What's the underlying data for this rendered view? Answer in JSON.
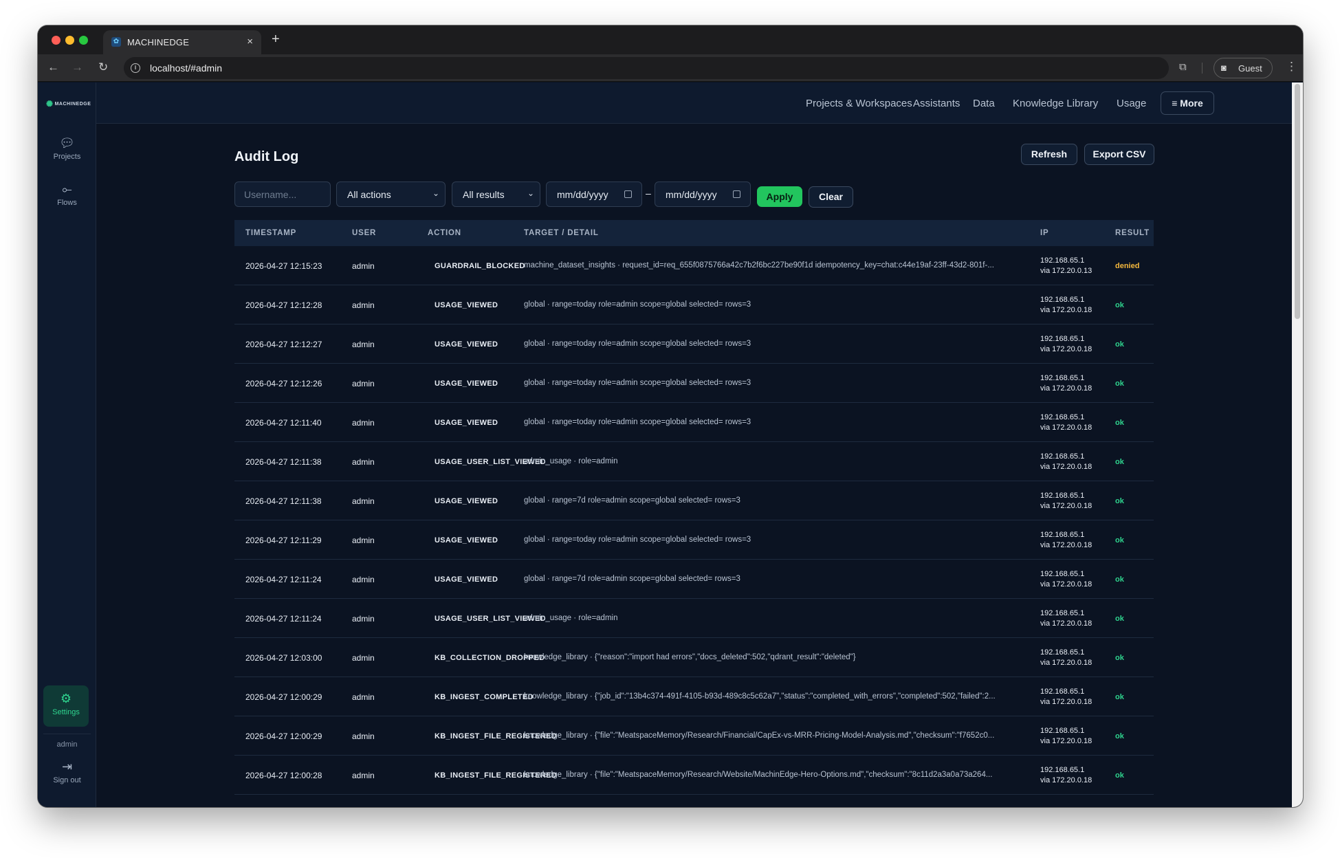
{
  "browser": {
    "tab_title": "MACHINEDGE",
    "url": "localhost/#admin",
    "guest_label": "Guest",
    "new_tab": "+",
    "close": "×"
  },
  "sidebar": {
    "logo": "MACHINEDGE",
    "items": [
      {
        "label": "Projects",
        "icon": "chat-bubble-icon"
      },
      {
        "label": "Flows",
        "icon": "flow-icon"
      }
    ],
    "settings_label": "Settings",
    "user": "admin",
    "signout_label": "Sign out"
  },
  "topnav": {
    "links": [
      "Projects & Workspaces",
      "Assistants",
      "Data",
      "Knowledge Library",
      "Usage"
    ],
    "more_label": "≡ More"
  },
  "page": {
    "title": "Audit Log",
    "refresh_label": "Refresh",
    "export_label": "Export CSV",
    "filters": {
      "username_placeholder": "Username...",
      "actions_value": "All actions",
      "results_value": "All results",
      "date_from": "mm/dd/yyyy",
      "date_to": "mm/dd/yyyy",
      "dash": "–",
      "apply_label": "Apply",
      "clear_label": "Clear"
    },
    "columns": [
      "TIMESTAMP",
      "USER",
      "ACTION",
      "TARGET / DETAIL",
      "IP",
      "RESULT"
    ],
    "rows": [
      {
        "ts": "2026-04-27 12:15:23",
        "user": "admin",
        "action": "GUARDRAIL_BLOCKED",
        "target": "machine_dataset_insights · request_id=req_655f0875766a42c7b2f6bc227be90f1d idempotency_key=chat:c44e19af-23ff-43d2-801f-...",
        "ip1": "192.168.65.1",
        "ip2": "via 172.20.0.13",
        "result": "denied"
      },
      {
        "ts": "2026-04-27 12:12:28",
        "user": "admin",
        "action": "USAGE_VIEWED",
        "target": "global · range=today role=admin scope=global selected= rows=3",
        "ip1": "192.168.65.1",
        "ip2": "via 172.20.0.18",
        "result": "ok"
      },
      {
        "ts": "2026-04-27 12:12:27",
        "user": "admin",
        "action": "USAGE_VIEWED",
        "target": "global · range=today role=admin scope=global selected= rows=3",
        "ip1": "192.168.65.1",
        "ip2": "via 172.20.0.18",
        "result": "ok"
      },
      {
        "ts": "2026-04-27 12:12:26",
        "user": "admin",
        "action": "USAGE_VIEWED",
        "target": "global · range=today role=admin scope=global selected= rows=3",
        "ip1": "192.168.65.1",
        "ip2": "via 172.20.0.18",
        "result": "ok"
      },
      {
        "ts": "2026-04-27 12:11:40",
        "user": "admin",
        "action": "USAGE_VIEWED",
        "target": "global · range=today role=admin scope=global selected= rows=3",
        "ip1": "192.168.65.1",
        "ip2": "via 172.20.0.18",
        "result": "ok"
      },
      {
        "ts": "2026-04-27 12:11:38",
        "user": "admin",
        "action": "USAGE_USER_LIST_VIEWED",
        "target": "admin_usage · role=admin",
        "ip1": "192.168.65.1",
        "ip2": "via 172.20.0.18",
        "result": "ok"
      },
      {
        "ts": "2026-04-27 12:11:38",
        "user": "admin",
        "action": "USAGE_VIEWED",
        "target": "global · range=7d role=admin scope=global selected= rows=3",
        "ip1": "192.168.65.1",
        "ip2": "via 172.20.0.18",
        "result": "ok"
      },
      {
        "ts": "2026-04-27 12:11:29",
        "user": "admin",
        "action": "USAGE_VIEWED",
        "target": "global · range=today role=admin scope=global selected= rows=3",
        "ip1": "192.168.65.1",
        "ip2": "via 172.20.0.18",
        "result": "ok"
      },
      {
        "ts": "2026-04-27 12:11:24",
        "user": "admin",
        "action": "USAGE_VIEWED",
        "target": "global · range=7d role=admin scope=global selected= rows=3",
        "ip1": "192.168.65.1",
        "ip2": "via 172.20.0.18",
        "result": "ok"
      },
      {
        "ts": "2026-04-27 12:11:24",
        "user": "admin",
        "action": "USAGE_USER_LIST_VIEWED",
        "target": "admin_usage · role=admin",
        "ip1": "192.168.65.1",
        "ip2": "via 172.20.0.18",
        "result": "ok"
      },
      {
        "ts": "2026-04-27 12:03:00",
        "user": "admin",
        "action": "KB_COLLECTION_DROPPED",
        "target": "knowledge_library · {\"reason\":\"import had errors\",\"docs_deleted\":502,\"qdrant_result\":\"deleted\"}",
        "ip1": "192.168.65.1",
        "ip2": "via 172.20.0.18",
        "result": "ok"
      },
      {
        "ts": "2026-04-27 12:00:29",
        "user": "admin",
        "action": "KB_INGEST_COMPLETED",
        "target": "knowledge_library · {\"job_id\":\"13b4c374-491f-4105-b93d-489c8c5c62a7\",\"status\":\"completed_with_errors\",\"completed\":502,\"failed\":2...",
        "ip1": "192.168.65.1",
        "ip2": "via 172.20.0.18",
        "result": "ok"
      },
      {
        "ts": "2026-04-27 12:00:29",
        "user": "admin",
        "action": "KB_INGEST_FILE_REGISTERED",
        "target": "knowledge_library · {\"file\":\"MeatspaceMemory/Research/Financial/CapEx-vs-MRR-Pricing-Model-Analysis.md\",\"checksum\":\"f7652c0...",
        "ip1": "192.168.65.1",
        "ip2": "via 172.20.0.18",
        "result": "ok"
      },
      {
        "ts": "2026-04-27 12:00:28",
        "user": "admin",
        "action": "KB_INGEST_FILE_REGISTERED",
        "target": "knowledge_library · {\"file\":\"MeatspaceMemory/Research/Website/MachinEdge-Hero-Options.md\",\"checksum\":\"8c11d2a3a0a73a264...",
        "ip1": "192.168.65.1",
        "ip2": "via 172.20.0.18",
        "result": "ok"
      }
    ]
  }
}
